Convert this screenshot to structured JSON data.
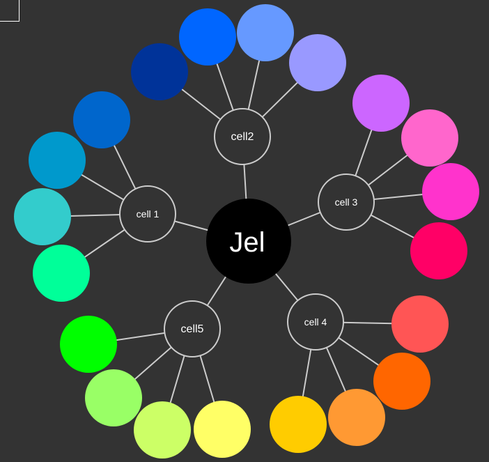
{
  "diagram": {
    "root": {
      "label": "Jel"
    },
    "hubs": [
      {
        "id": "cell1",
        "label": "cell 1",
        "leaf_colors": [
          "#0066cc",
          "#0099cc",
          "#33cccc",
          "#00ff99"
        ]
      },
      {
        "id": "cell2",
        "label": "cell2",
        "leaf_colors": [
          "#003399",
          "#0066ff",
          "#6699ff",
          "#9999ff"
        ]
      },
      {
        "id": "cell3",
        "label": "cell 3",
        "leaf_colors": [
          "#cc66ff",
          "#ff66cc",
          "#ff33cc",
          "#ff0066"
        ]
      },
      {
        "id": "cell4",
        "label": "cell 4",
        "leaf_colors": [
          "#ff5555",
          "#ff6600",
          "#ff9933",
          "#ffcc00"
        ]
      },
      {
        "id": "cell5",
        "label": "cell5",
        "leaf_colors": [
          "#00ff00",
          "#99ff66",
          "#ccff66",
          "#ffff66"
        ]
      }
    ],
    "colors": {
      "background": "#333333",
      "root_fill": "#000000",
      "hub_stroke": "#cccccc",
      "link_stroke": "#cccccc",
      "text": "#ffffff"
    }
  }
}
